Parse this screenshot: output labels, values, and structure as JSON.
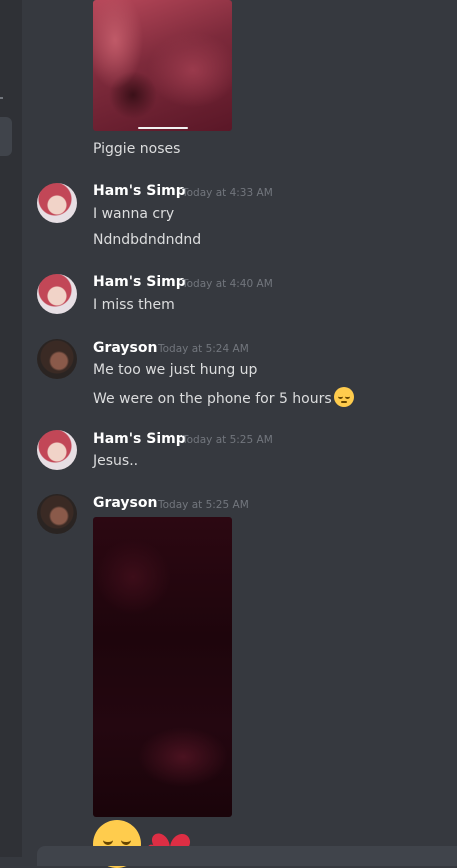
{
  "messages": [
    {
      "kind": "image_caption",
      "text": "Piggie noses"
    },
    {
      "author": "Ham's Simp",
      "timestamp": "Today at 4:33 AM",
      "lines": [
        "I wanna cry",
        "Ndndbdndndnd"
      ]
    },
    {
      "author": "Ham's Simp",
      "timestamp": "Today at 4:40 AM",
      "lines": [
        "I miss them"
      ]
    },
    {
      "author": "Grayson",
      "timestamp": "Today at 5:24 AM",
      "lines": [
        "Me too we just hung up",
        "We were on the phone for 5 hours"
      ]
    },
    {
      "author": "Ham's Simp",
      "timestamp": "Today at 5:25 AM",
      "lines": [
        "Jesus.."
      ]
    },
    {
      "author": "Grayson",
      "timestamp": "Today at 5:25 AM",
      "lines": []
    }
  ],
  "icons": {
    "inline_emoji": "pensive-face-emoji",
    "big_emoji": "pensive-face-emoji",
    "reaction_emoji": "two-hearts-emoji"
  },
  "colors": {
    "background": "#36393f",
    "sidebar": "#2f3136",
    "author": "#ffffff",
    "timestamp": "#72767d",
    "text": "#dcddde",
    "heart": "#dd2e44"
  }
}
